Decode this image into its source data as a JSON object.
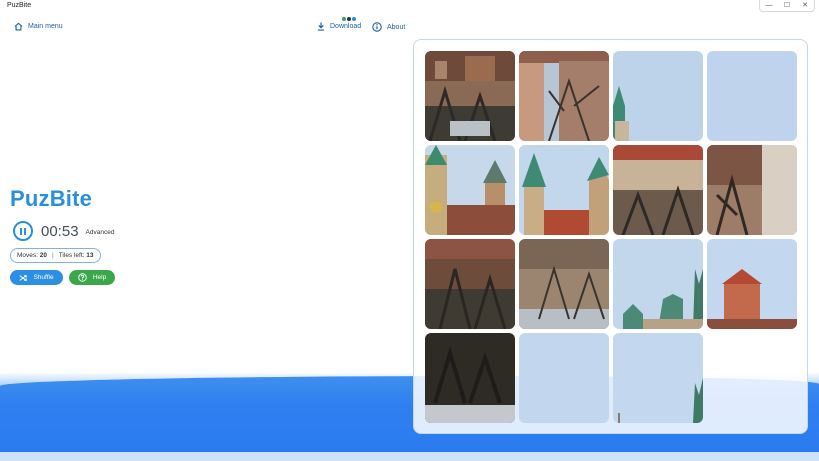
{
  "window": {
    "title": "PuzBite",
    "controls": [
      "—",
      "☐",
      "✕"
    ]
  },
  "nav": {
    "main_menu": "Main menu",
    "download": "Download",
    "about": "About"
  },
  "game": {
    "title": "PuzBite",
    "timer": "00:53",
    "difficulty": "Advanced",
    "moves_label": "Moves:",
    "moves": "20",
    "tiles_left_label": "Tiles left:",
    "tiles_left": "13",
    "shuffle_label": "Shuffle",
    "help_label": "Help"
  },
  "colors": {
    "accent": "#2a8fdc",
    "shuffle": "#2b8fe3",
    "help": "#3aa84a",
    "wave": "#2f7ff0"
  },
  "board": {
    "grid": "4x4",
    "tiles": [
      {
        "id": "tile-1",
        "scene": "buildings-trees"
      },
      {
        "id": "tile-2",
        "scene": "building-bare-tree"
      },
      {
        "id": "tile-3",
        "scene": "sky-green-spire"
      },
      {
        "id": "tile-4",
        "scene": "sky"
      },
      {
        "id": "tile-5",
        "scene": "clock-tower"
      },
      {
        "id": "tile-6",
        "scene": "cathedral-towers"
      },
      {
        "id": "tile-7",
        "scene": "building-red-roof"
      },
      {
        "id": "tile-8",
        "scene": "buildings-trees-right"
      },
      {
        "id": "tile-9",
        "scene": "brick-building-trees"
      },
      {
        "id": "tile-10",
        "scene": "wall-trees"
      },
      {
        "id": "tile-11",
        "scene": "green-domes"
      },
      {
        "id": "tile-12",
        "scene": "round-tower"
      },
      {
        "id": "tile-13",
        "scene": "dark-trees-riverside"
      },
      {
        "id": "tile-14",
        "scene": "sky"
      },
      {
        "id": "tile-15",
        "scene": "sky-spire-base"
      },
      {
        "id": "tile-16",
        "scene": "empty"
      }
    ]
  }
}
